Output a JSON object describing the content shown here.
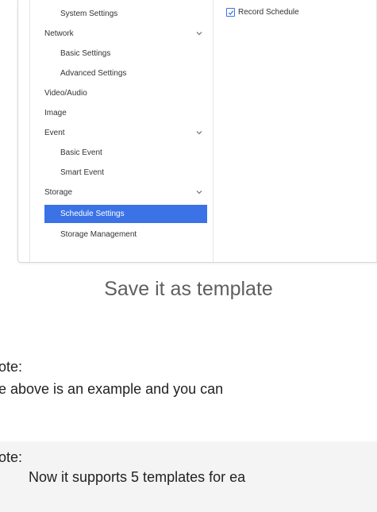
{
  "sidebar": {
    "items": [
      {
        "label": "System Settings",
        "level": 2
      },
      {
        "label": "Network",
        "level": 1,
        "expanded": true
      },
      {
        "label": "Basic Settings",
        "level": 2
      },
      {
        "label": "Advanced Settings",
        "level": 2
      },
      {
        "label": "Video/Audio",
        "level": 1
      },
      {
        "label": "Image",
        "level": 1
      },
      {
        "label": "Event",
        "level": 1,
        "expanded": true
      },
      {
        "label": "Basic Event",
        "level": 2
      },
      {
        "label": "Smart Event",
        "level": 2
      },
      {
        "label": "Storage",
        "level": 1,
        "expanded": true
      },
      {
        "label": "Schedule Settings",
        "level": 2,
        "selected": true
      },
      {
        "label": "Storage Management",
        "level": 2
      }
    ]
  },
  "main": {
    "record_schedule_label": "Record Schedule",
    "record_schedule_checked": true
  },
  "caption": "Save it as template",
  "note1": {
    "label": "ote:",
    "text": "e above is  an example and you can"
  },
  "note2": {
    "label": "ote:",
    "text": "Now it supports 5 templates for ea"
  },
  "colors": {
    "accent": "#3b73e6",
    "caption": "#5f5f5f",
    "note_bg": "#f4f4f4"
  }
}
